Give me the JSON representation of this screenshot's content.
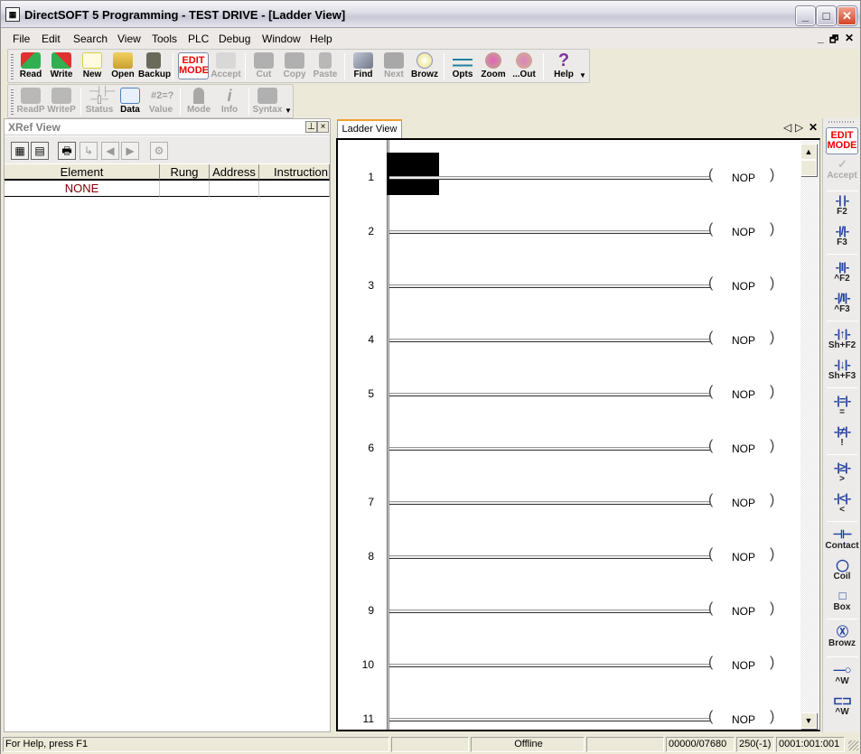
{
  "window": {
    "title": "DirectSOFT 5 Programming - TEST DRIVE - [Ladder View]",
    "controls": {
      "minimize": "_",
      "maximize": "□",
      "close": "✕"
    },
    "mdi_controls": {
      "minimize": "_",
      "restore": "🗗",
      "close": "✕"
    }
  },
  "menu": [
    "File",
    "Edit",
    "Search",
    "View",
    "Tools",
    "PLC",
    "Debug",
    "Window",
    "Help"
  ],
  "toolbar1": {
    "buttons": [
      {
        "label": "Read",
        "icon": "read-icon",
        "enabled": true
      },
      {
        "label": "Write",
        "icon": "write-icon",
        "enabled": true
      },
      {
        "label": "New",
        "icon": "new-icon",
        "enabled": true
      },
      {
        "label": "Open",
        "icon": "open-icon",
        "enabled": true
      },
      {
        "label": "Backup",
        "icon": "backup-icon",
        "enabled": true
      },
      {
        "label": "EDIT MODE",
        "icon": "edit-mode-icon",
        "enabled": true
      },
      {
        "label": "Accept",
        "icon": "accept-icon",
        "enabled": false
      },
      {
        "label": "Cut",
        "icon": "cut-icon",
        "enabled": false
      },
      {
        "label": "Copy",
        "icon": "copy-icon",
        "enabled": false
      },
      {
        "label": "Paste",
        "icon": "paste-icon",
        "enabled": false
      },
      {
        "label": "Find",
        "icon": "find-icon",
        "enabled": true
      },
      {
        "label": "Next",
        "icon": "next-icon",
        "enabled": false
      },
      {
        "label": "Browz",
        "icon": "browse-icon",
        "enabled": true
      },
      {
        "label": "Opts",
        "icon": "options-icon",
        "enabled": true
      },
      {
        "label": "Zoom",
        "icon": "zoom-in-icon",
        "enabled": true
      },
      {
        "label": "...Out",
        "icon": "zoom-out-icon",
        "enabled": true
      },
      {
        "label": "Help",
        "icon": "help-icon",
        "enabled": true
      }
    ]
  },
  "toolbar2": {
    "buttons": [
      {
        "label": "ReadP",
        "enabled": false
      },
      {
        "label": "WriteP",
        "enabled": false
      },
      {
        "label": "Status",
        "enabled": false
      },
      {
        "label": "Data",
        "enabled": true
      },
      {
        "label": "Value",
        "enabled": false
      },
      {
        "label": "Mode",
        "enabled": false
      },
      {
        "label": "Info",
        "enabled": false
      },
      {
        "label": "Syntax",
        "enabled": false
      }
    ]
  },
  "xref": {
    "title": "XRef View",
    "pin": "⊥",
    "close": "×",
    "columns": [
      "Element",
      "Rung",
      "Address",
      "Instruction"
    ],
    "rows": [
      [
        "NONE",
        "",
        "",
        ""
      ]
    ]
  },
  "ladder": {
    "tab": "Ladder View",
    "nav": {
      "prev": "◁",
      "next": "▷",
      "close": "✕"
    },
    "rungs": [
      {
        "num": "1",
        "instruction": "NOP"
      },
      {
        "num": "2",
        "instruction": "NOP"
      },
      {
        "num": "3",
        "instruction": "NOP"
      },
      {
        "num": "4",
        "instruction": "NOP"
      },
      {
        "num": "5",
        "instruction": "NOP"
      },
      {
        "num": "6",
        "instruction": "NOP"
      },
      {
        "num": "7",
        "instruction": "NOP"
      },
      {
        "num": "8",
        "instruction": "NOP"
      },
      {
        "num": "9",
        "instruction": "NOP"
      },
      {
        "num": "10",
        "instruction": "NOP"
      },
      {
        "num": "11",
        "instruction": "NOP"
      }
    ],
    "coil_open": "(",
    "coil_close": ")"
  },
  "palette": {
    "buttons": [
      {
        "glyph": "EDIT MODE",
        "label": ""
      },
      {
        "glyph": "✓",
        "label": "Accept"
      },
      {
        "glyph": "-| |-",
        "label": "F2"
      },
      {
        "glyph": "-|/|-",
        "label": "F3"
      },
      {
        "glyph": "-|I|-",
        "label": "^F2"
      },
      {
        "glyph": "-|/I|-",
        "label": "^F3"
      },
      {
        "glyph": "-|↑|-",
        "label": "Sh+F2"
      },
      {
        "glyph": "-|↓|-",
        "label": "Sh+F3"
      },
      {
        "glyph": "-|=|-",
        "label": "="
      },
      {
        "glyph": "-|≠|-",
        "label": "!"
      },
      {
        "glyph": "-|≥|-",
        "label": ">"
      },
      {
        "glyph": "-|<|-",
        "label": "<"
      },
      {
        "glyph": "⊣⊢",
        "label": "Contact"
      },
      {
        "glyph": "◯",
        "label": "Coil"
      },
      {
        "glyph": "□",
        "label": "Box"
      },
      {
        "glyph": "Ⓧ",
        "label": "Browz"
      },
      {
        "glyph": "—○",
        "label": "^W"
      },
      {
        "glyph": "⊏⊐",
        "label": "^W"
      }
    ]
  },
  "status": {
    "help": "For Help, press F1",
    "panel1": "",
    "mode": "Offline",
    "panel3": "",
    "memory": "00000/07680",
    "rung_info": "250(-1)",
    "position": "0001:001:001"
  }
}
